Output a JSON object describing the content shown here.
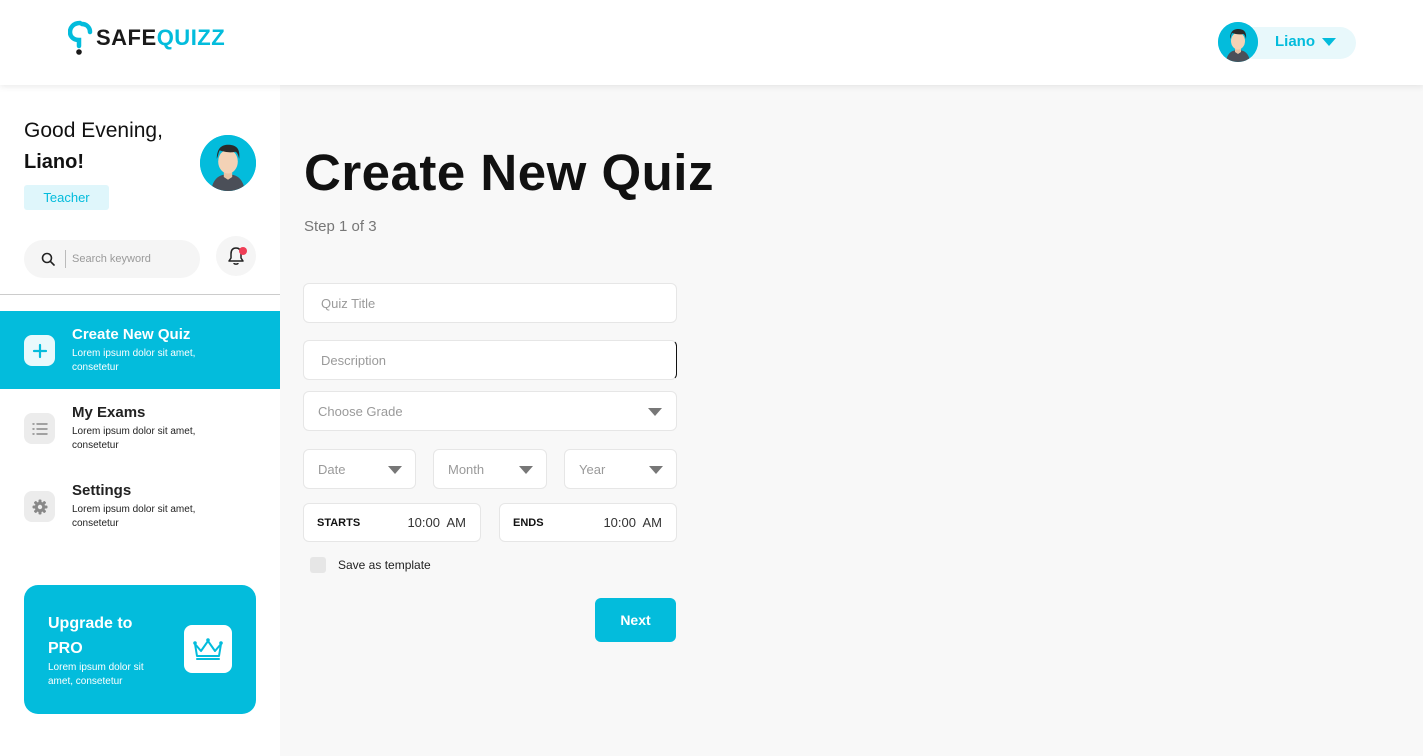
{
  "brand": {
    "name_part1": "SAFE",
    "name_part2": "QUIZZ"
  },
  "header": {
    "user_name": "Liano"
  },
  "sidebar": {
    "greeting": "Good Evening,",
    "user_name": "Liano!",
    "role": "Teacher",
    "search": {
      "placeholder": "Search keyword"
    },
    "nav": [
      {
        "title": "Create New Quiz",
        "desc": "Lorem ipsum dolor sit amet, consetetur",
        "active": true,
        "icon": "plus-icon"
      },
      {
        "title": "My Exams",
        "desc": "Lorem ipsum dolor sit amet, consetetur",
        "active": false,
        "icon": "list-icon"
      },
      {
        "title": "Settings",
        "desc": "Lorem ipsum dolor sit amet, consetetur",
        "active": false,
        "icon": "gear-icon"
      }
    ],
    "promo": {
      "title": "Upgrade to PRO",
      "desc": "Lorem ipsum dolor sit amet, consetetur",
      "icon": "crown-icon"
    }
  },
  "main": {
    "title": "Create New Quiz",
    "step": "Step 1 of 3",
    "form": {
      "quiz_title_placeholder": "Quiz Title",
      "description_placeholder": "Description",
      "grade_placeholder": "Choose Grade",
      "date_placeholder": "Date",
      "month_placeholder": "Month",
      "year_placeholder": "Year",
      "starts_label": "STARTS",
      "starts_value": "10:00  AM",
      "ends_label": "ENDS",
      "ends_value": "10:00  AM",
      "template_label": "Save as template",
      "next_label": "Next"
    }
  },
  "colors": {
    "accent": "#03bcdc",
    "notification": "#ef3e56"
  }
}
